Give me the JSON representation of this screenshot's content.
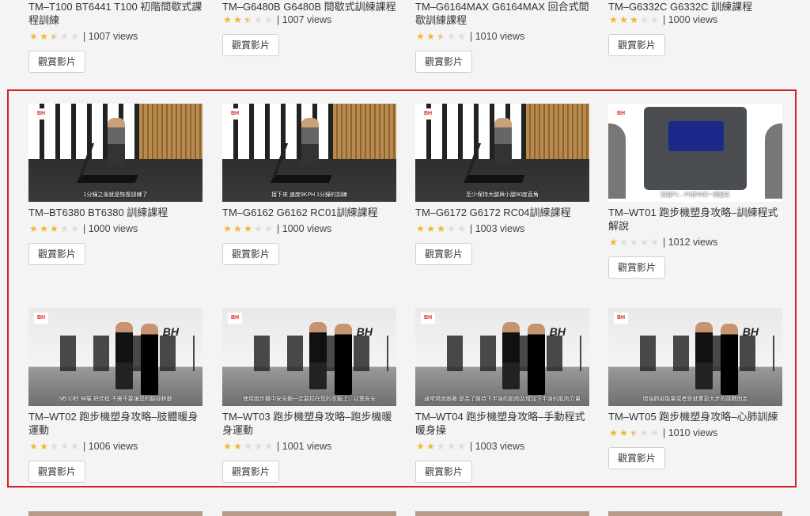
{
  "button_label": "觀賞影片",
  "colors": {
    "star": "#f0b82c",
    "highlight": "#d32020"
  },
  "row0": [
    {
      "title": "TM–T100 BT6441 T100 初階間歇式課程訓練",
      "rating": 2.5,
      "views": "| 1007 views"
    },
    {
      "title": "TM–G6480B G6480B 間歇式訓練課程",
      "rating": 2.5,
      "views": "| 1007 views"
    },
    {
      "title": "TM–G6164MAX G6164MAX 回合式間歇訓練課程",
      "rating": 2.5,
      "views": "| 1010 views"
    },
    {
      "title": "TM–G6332C G6332C 訓練課程",
      "rating": 3,
      "views": "| 1000 views"
    }
  ],
  "row1": [
    {
      "title": "TM–BT6380 BT6380 訓練課程",
      "rating": 3,
      "views": "| 1000 views",
      "caption": "1分鐘之後就是恢復訓練了"
    },
    {
      "title": "TM–G6162 G6162 RC01訓練課程",
      "rating": 3,
      "views": "| 1000 views",
      "caption": "接下來 速度9KPH 1分鐘的訓練"
    },
    {
      "title": "TM–G6172 G6172 RC04訓練課程",
      "rating": 3,
      "views": "| 1003 views",
      "caption": "至少保持大腿與小腿90度直角"
    },
    {
      "title": "TM–WT01 跑步機塑身攻略–訓練程式解說",
      "rating": 1,
      "views": "| 1012 views",
      "caption": "點選P1…P6其中的一個程式"
    }
  ],
  "row2": [
    {
      "title": "TM–WT02 跑步機塑身攻略–肢體暖身運動",
      "rating": 2,
      "views": "| 1006 views",
      "caption": "5秒10秒 伸展 把佳程 不需不要讓您的腳部移動"
    },
    {
      "title": "TM–WT03 跑步機塑身攻略–跑步機暖身運動",
      "rating": 2,
      "views": "| 1001 views",
      "caption": "使用跑步機中安全鎖一定要扣在您的衣服上，以策安全"
    },
    {
      "title": "TM–WT04 跑步機塑身攻略–手動程式暖身操",
      "rating": 2,
      "views": "| 1003 views",
      "caption": "通常燒度跟著 是為了維持下半身的肌肉及增加下半身的肌肉力量"
    },
    {
      "title": "TM–WT05 跑步機塑身攻略–心肺訓練",
      "rating": 2.5,
      "views": "| 1010 views",
      "caption": "增強肺部能量或者是就業更大步的挑戰而走"
    }
  ],
  "logo": {
    "text": "BH",
    "sub": "FITNESS"
  }
}
